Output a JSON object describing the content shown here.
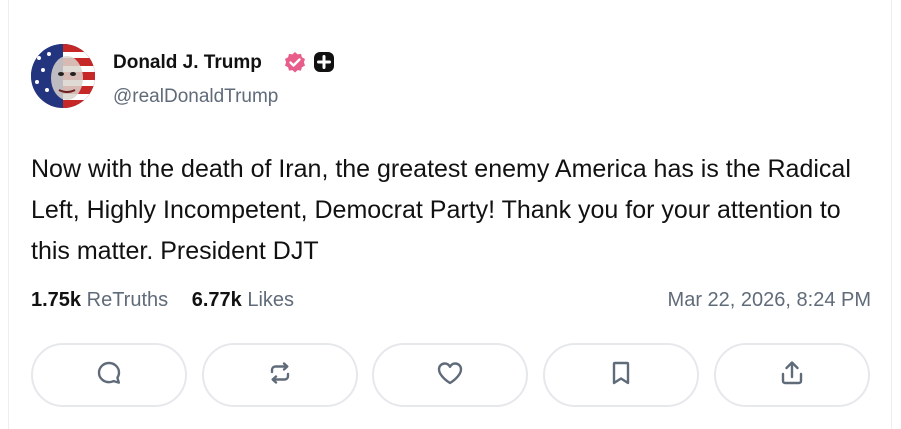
{
  "post": {
    "author_name": "Donald J. Trump",
    "handle": "@realDonaldTrump",
    "text": "Now with the death of Iran, the greatest enemy America has is the Radical Left, Highly Incompetent, Democrat Party! Thank you for your attention to this matter. President DJT",
    "retruths_count": "1.75k",
    "retruths_label": "ReTruths",
    "likes_count": "6.77k",
    "likes_label": "Likes",
    "timestamp": "Mar 22, 2026, 8:24 PM"
  },
  "colors": {
    "verified_badge": "#e85d8a",
    "text_primary": "#111111",
    "text_secondary": "#606b7a",
    "border": "#e6e8ec"
  },
  "actions": [
    {
      "icon": "reply-icon"
    },
    {
      "icon": "retruth-icon"
    },
    {
      "icon": "like-icon"
    },
    {
      "icon": "bookmark-icon"
    },
    {
      "icon": "share-icon"
    }
  ]
}
